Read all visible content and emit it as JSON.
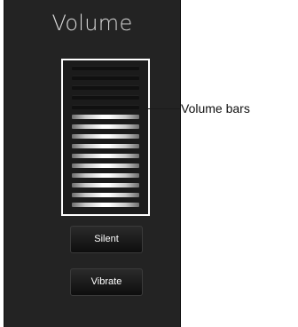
{
  "panel": {
    "title": "Volume"
  },
  "volume": {
    "total_bars": 15,
    "active_bars": 10
  },
  "buttons": {
    "silent_label": "Silent",
    "vibrate_label": "Vibrate"
  },
  "callout": {
    "label": "Volume bars"
  },
  "colors": {
    "panel_background": "#232323",
    "frame_border": "#ffffff",
    "active_bar": "#ffffff",
    "inactive_bar": "#101010"
  }
}
